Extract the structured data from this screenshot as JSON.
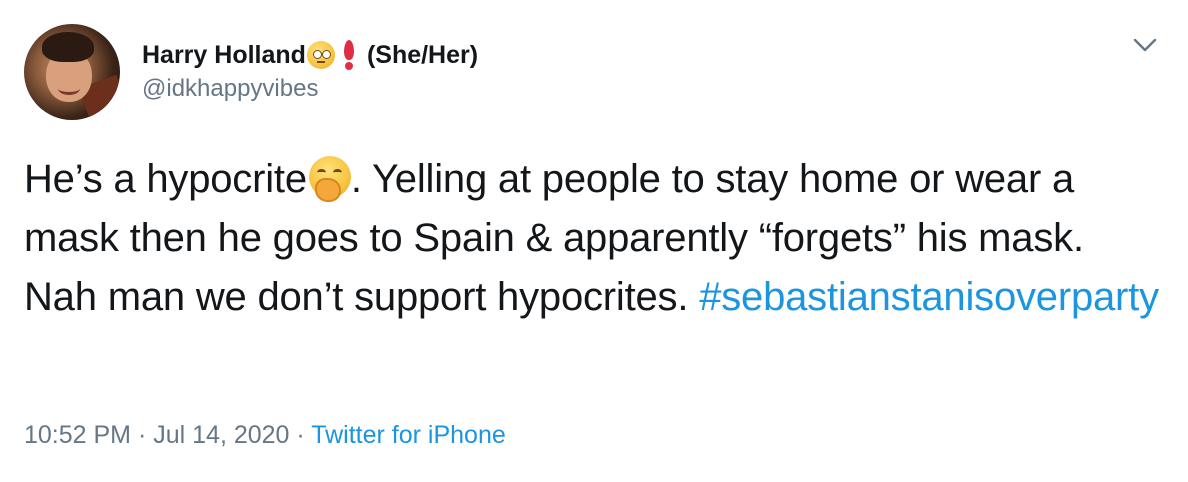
{
  "author": {
    "display_name": "Harry Holland",
    "pronouns": "(She/Her)",
    "handle": "@idkhappyvibes",
    "name_emojis": [
      "face-with-rolling-eyes",
      "heavy-heart-exclamation"
    ]
  },
  "tweet": {
    "text_before_emoji": "He’s a hypocrite",
    "emoji": "yawning-face",
    "text_after_emoji": ". Yelling at people to stay home or wear a mask then he goes to Spain & apparently “forgets” his mask. Nah man we don’t support hypocrites. ",
    "hashtag": "#sebastianstanisoverparty"
  },
  "meta": {
    "time": "10:52 PM",
    "separator1": " · ",
    "date": "Jul 14, 2020",
    "separator2": " · ",
    "source": "Twitter for iPhone"
  },
  "colors": {
    "text": "#14171a",
    "secondary": "#657786",
    "link": "#1b95e0",
    "heart": "#dd2e44"
  },
  "icons": {
    "menu": "chevron-down-icon"
  }
}
